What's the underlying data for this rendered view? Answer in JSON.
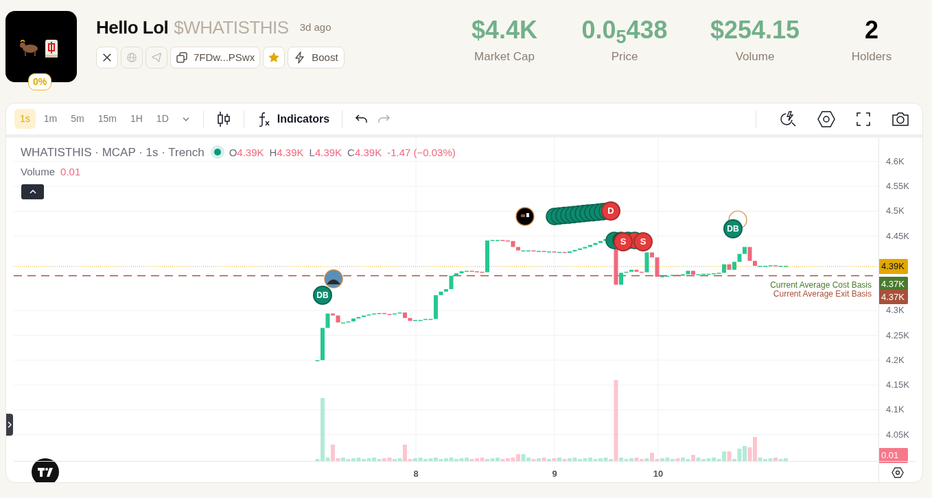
{
  "token": {
    "name": "Hello Lol",
    "ticker": "$WHATISTHIS",
    "age": "3d ago",
    "progress": "0%",
    "address": "7FDw...PSwx",
    "favorite": true,
    "boost": "Boost",
    "links": [
      {
        "kind": "x",
        "enabled": true
      },
      {
        "kind": "website",
        "enabled": false
      },
      {
        "kind": "telegram",
        "enabled": false
      }
    ]
  },
  "stats": [
    {
      "value": "$4.4K",
      "label": "Market Cap",
      "color": "#72b08a"
    },
    {
      "value": "0.0$_{5}$438",
      "label": "Price",
      "color": "#72b08a"
    },
    {
      "value": "$254.15",
      "label": "Volume",
      "color": "#72b08a"
    },
    {
      "value": "2",
      "label": "Holders",
      "color": "#000000"
    }
  ],
  "toolbar": {
    "timeframes": [
      {
        "label": "1s",
        "selected": true
      },
      {
        "label": "1m",
        "selected": false
      },
      {
        "label": "5m",
        "selected": false
      },
      {
        "label": "15m",
        "selected": false
      },
      {
        "label": "1H",
        "selected": false
      },
      {
        "label": "1D",
        "selected": false
      }
    ],
    "indicators": "Indicators",
    "undo_enabled": true,
    "redo_enabled": false
  },
  "legend": {
    "title": "WHATISTHIS · MCAP · 1s · Trench",
    "ohlc": [
      {
        "key": "O",
        "value": "4.39K"
      },
      {
        "key": "H",
        "value": "4.39K"
      },
      {
        "key": "L",
        "value": "4.39K"
      },
      {
        "key": "C",
        "value": "4.39K"
      }
    ],
    "change": "-1.47 (−0.03%)",
    "volume_label": "Volume",
    "volume_value": "0.01"
  },
  "last_price": {
    "text": "4.39K",
    "color": "#e2a800"
  },
  "price_lines": [
    {
      "label": "Current Average Cost Basis",
      "price": "4.37K",
      "color": "#4a7a2e"
    },
    {
      "label": "Current Average Exit Basis",
      "price": "4.37K",
      "color": "#a8513a"
    }
  ],
  "volume_last": "0.01",
  "markers": [
    {
      "label": "DB",
      "color": "#0e8a6e"
    },
    {
      "label": "D",
      "color": "#e33c3c"
    },
    {
      "label": "S",
      "color": "#e33c3c"
    },
    {
      "label": "S",
      "color": "#e33c3c"
    },
    {
      "label": "DB",
      "color": "#0e8a6e"
    }
  ],
  "y_axis_labels": [
    "4.6K",
    "4.55K",
    "4.5K",
    "4.45K",
    "4.3K",
    "4.25K",
    "4.2K",
    "4.15K",
    "4.1K",
    "4.05K"
  ],
  "x_axis_labels": [
    "8",
    "9",
    "10"
  ]
}
